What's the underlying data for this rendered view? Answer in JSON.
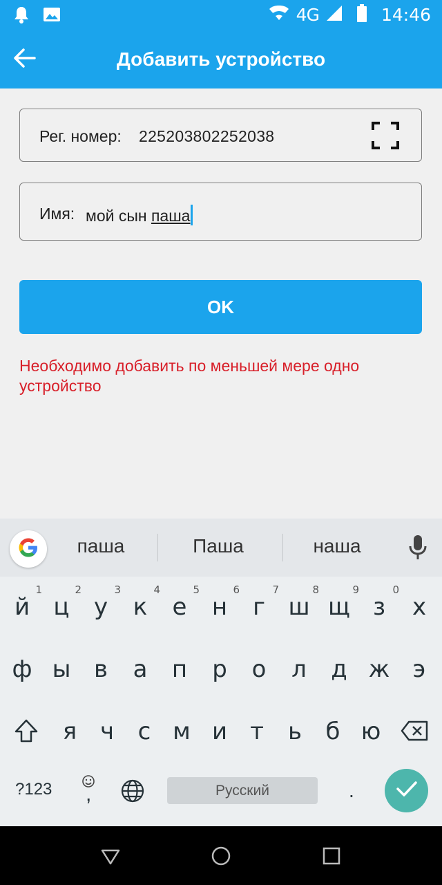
{
  "status_bar": {
    "network": "4G",
    "time": "14:46"
  },
  "app_bar": {
    "title": "Добавить устройство"
  },
  "reg_field": {
    "label": "Рег. номер:",
    "value": "225203802252038"
  },
  "name_field": {
    "label": "Имя:",
    "value_prefix": "мой сын ",
    "value_composing": "паша"
  },
  "ok_button": {
    "label": "OK"
  },
  "error_message": "Необходимо добавить по меньшей мере одно устройство",
  "keyboard": {
    "suggestions": [
      "паша",
      "Паша",
      "наша"
    ],
    "row1": [
      "й",
      "ц",
      "у",
      "к",
      "е",
      "н",
      "г",
      "ш",
      "щ",
      "з",
      "х"
    ],
    "row1_hints": [
      "1",
      "2",
      "3",
      "4",
      "5",
      "6",
      "7",
      "8",
      "9",
      "0"
    ],
    "row2": [
      "ф",
      "ы",
      "в",
      "а",
      "п",
      "р",
      "о",
      "л",
      "д",
      "ж",
      "э"
    ],
    "row3": [
      "я",
      "ч",
      "с",
      "м",
      "и",
      "т",
      "ь",
      "б",
      "ю"
    ],
    "symbols_key": "?123",
    "comma_key": ",",
    "space_label": "Русский",
    "period_key": "."
  },
  "accent_color": "#1ba4ec",
  "error_color": "#d8202a"
}
